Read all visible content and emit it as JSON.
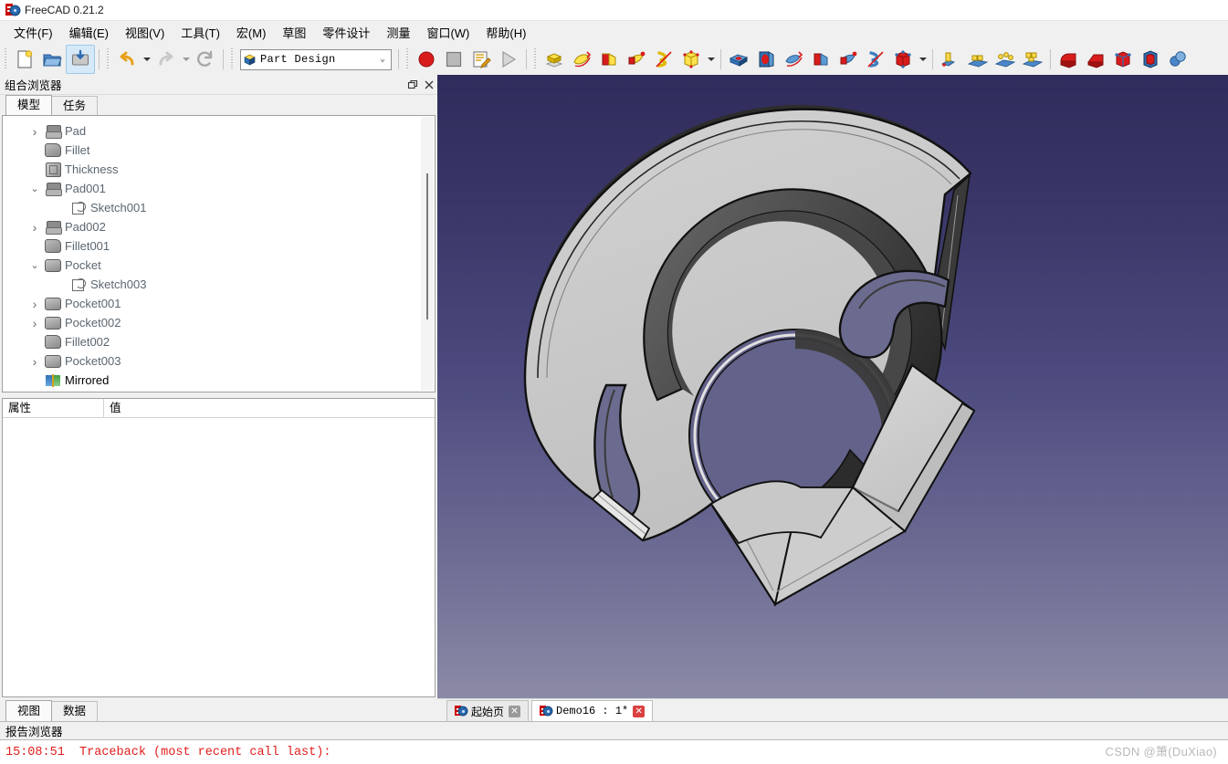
{
  "window": {
    "title": "FreeCAD 0.21.2",
    "logo_icon": "freecad-logo-icon"
  },
  "menubar": {
    "items": [
      {
        "label": "文件(F)",
        "name": "menu-file"
      },
      {
        "label": "编辑(E)",
        "name": "menu-edit"
      },
      {
        "label": "视图(V)",
        "name": "menu-view"
      },
      {
        "label": "工具(T)",
        "name": "menu-tools"
      },
      {
        "label": "宏(M)",
        "name": "menu-macro"
      },
      {
        "label": "草图",
        "name": "menu-sketch"
      },
      {
        "label": "零件设计",
        "name": "menu-part-design"
      },
      {
        "label": "测量",
        "name": "menu-measure"
      },
      {
        "label": "窗口(W)",
        "name": "menu-window"
      },
      {
        "label": "帮助(H)",
        "name": "menu-help"
      }
    ]
  },
  "toolbar_top": {
    "workbench_selector": {
      "value": "Part Design",
      "icon": "workbench-icon",
      "chevron": "chevron-down-icon"
    },
    "file_group": [
      "new-document-icon",
      "open-document-icon",
      "save-document-icon"
    ],
    "edit_group": [
      "undo-icon",
      "undo-dropdown-icon",
      "redo-icon",
      "redo-dropdown-icon",
      "refresh-icon"
    ],
    "macro_group": [
      "macro-record-icon",
      "macro-stop-icon",
      "macro-edit-icon",
      "macro-execute-icon"
    ],
    "partdesign_additive": [
      "pad-icon",
      "revolution-icon",
      "additive-loft-icon",
      "additive-pipe-icon",
      "additive-helix-icon",
      "additive-primitive-icon",
      "additive-primitive-dropdown-icon"
    ],
    "partdesign_subtractive": [
      "pocket-icon",
      "hole-icon",
      "groove-icon",
      "subtractive-loft-icon",
      "subtractive-pipe-icon",
      "subtractive-helix-icon",
      "subtractive-primitive-icon",
      "subtractive-primitive-dropdown-icon"
    ],
    "partdesign_transform": [
      "mirrored-icon",
      "linear-pattern-icon",
      "polar-pattern-icon",
      "multi-transform-icon"
    ],
    "partdesign_dress": [
      "fillet-icon",
      "chamfer-icon",
      "draft-icon",
      "thickness-icon",
      "boolean-icon"
    ]
  },
  "toolbar_second": {
    "view_group": [
      "fit-all-icon",
      "fit-selection-icon",
      "draw-style-icon",
      "draw-style-dropdown-icon",
      "selection-view-icon"
    ],
    "nav_group": [
      "back-icon",
      "forward-icon",
      "std-views-icon",
      "std-views-dropdown-icon",
      "zoom-icon",
      "zoom-dropdown-icon"
    ],
    "std_views": [
      "axonometric-icon",
      "front-view-icon",
      "top-view-icon",
      "right-view-icon",
      "rear-view-icon",
      "bottom-view-icon",
      "left-view-icon",
      "measure-distance-icon"
    ],
    "help_group": [
      "whats-this-icon"
    ],
    "part_group": [
      "part-box-icon",
      "folder-icon",
      "export-icon",
      "export-dropdown-more-icon",
      "export-dropdown-icon"
    ],
    "sketch_group": [
      "create-sketch-icon",
      "edit-sketch-icon",
      "attach-sketch-icon",
      "map-sketch-icon",
      "validate-sketch-icon"
    ],
    "geom_group": [
      "point-icon",
      "line-icon",
      "polyline-icon",
      "datum-coord-icon",
      "datum-plane-icon",
      "datum-surface-icon",
      "sheep-icon"
    ],
    "measure_group": [
      "measure-icon",
      "measure-angle-icon",
      "measure-refresh-icon",
      "measure-delete-icon",
      "measure-toggle-icon",
      "measure-clear-icon"
    ]
  },
  "combo_view": {
    "title": "组合浏览器",
    "float_icon": "restore-icon",
    "close_icon": "close-icon",
    "tabs": [
      {
        "label": "模型",
        "active": true,
        "name": "tab-model"
      },
      {
        "label": "任务",
        "active": false,
        "name": "tab-tasks"
      }
    ],
    "tree": [
      {
        "label": "Pad",
        "icon": "pad-icon",
        "indent": 1,
        "twist": "collapsed",
        "active": false
      },
      {
        "label": "Fillet",
        "icon": "fillet-icon",
        "indent": 1,
        "twist": "none",
        "active": false
      },
      {
        "label": "Thickness",
        "icon": "thickness-icon",
        "indent": 1,
        "twist": "none",
        "active": false
      },
      {
        "label": "Pad001",
        "icon": "pad-icon",
        "indent": 1,
        "twist": "expanded",
        "active": false
      },
      {
        "label": "Sketch001",
        "icon": "sketch-icon",
        "indent": 2,
        "twist": "none",
        "active": false
      },
      {
        "label": "Pad002",
        "icon": "pad-icon",
        "indent": 1,
        "twist": "collapsed",
        "active": false
      },
      {
        "label": "Fillet001",
        "icon": "fillet-icon",
        "indent": 1,
        "twist": "none",
        "active": false
      },
      {
        "label": "Pocket",
        "icon": "pocket-icon",
        "indent": 1,
        "twist": "expanded",
        "active": false
      },
      {
        "label": "Sketch003",
        "icon": "sketch-icon",
        "indent": 2,
        "twist": "none",
        "active": false
      },
      {
        "label": "Pocket001",
        "icon": "pocket-icon",
        "indent": 1,
        "twist": "collapsed",
        "active": false
      },
      {
        "label": "Pocket002",
        "icon": "pocket-icon",
        "indent": 1,
        "twist": "collapsed",
        "active": false
      },
      {
        "label": "Fillet002",
        "icon": "fillet-icon",
        "indent": 1,
        "twist": "none",
        "active": false
      },
      {
        "label": "Pocket003",
        "icon": "pocket-icon",
        "indent": 1,
        "twist": "collapsed",
        "active": false
      },
      {
        "label": "Mirrored",
        "icon": "mirrored-icon",
        "indent": 1,
        "twist": "none",
        "active": true
      }
    ],
    "property_editor": {
      "columns": [
        "属性",
        "值"
      ],
      "rows": []
    },
    "bottom_tabs": [
      {
        "label": "视图",
        "active": true,
        "name": "tab-view"
      },
      {
        "label": "数据",
        "active": false,
        "name": "tab-data"
      }
    ]
  },
  "document_tabs": [
    {
      "label": "起始页",
      "active": false,
      "icon": "freecad-logo-icon",
      "close": "close-icon"
    },
    {
      "label": "Demo16 : 1*",
      "active": true,
      "icon": "freecad-logo-icon",
      "close": "close-icon"
    }
  ],
  "viewport": {
    "background_top": "#2f2c5c",
    "background_bottom": "#8b8aa6",
    "model_face": "#c6c6c6",
    "model_shadow": "#3a3a3a",
    "model_edge": "#141414",
    "description": "Shaded 3D CAD part: annular brake-shield-like sheet-metal body with central bore, two kidney slots and a flat tab"
  },
  "report_browser": {
    "title": "报告浏览器",
    "lines": [
      {
        "time": "15:08:51",
        "text": "Traceback (most recent call last):",
        "color": "#e11d1d"
      }
    ]
  },
  "watermark": {
    "text": "CSDN @箫(DuXiao)"
  }
}
